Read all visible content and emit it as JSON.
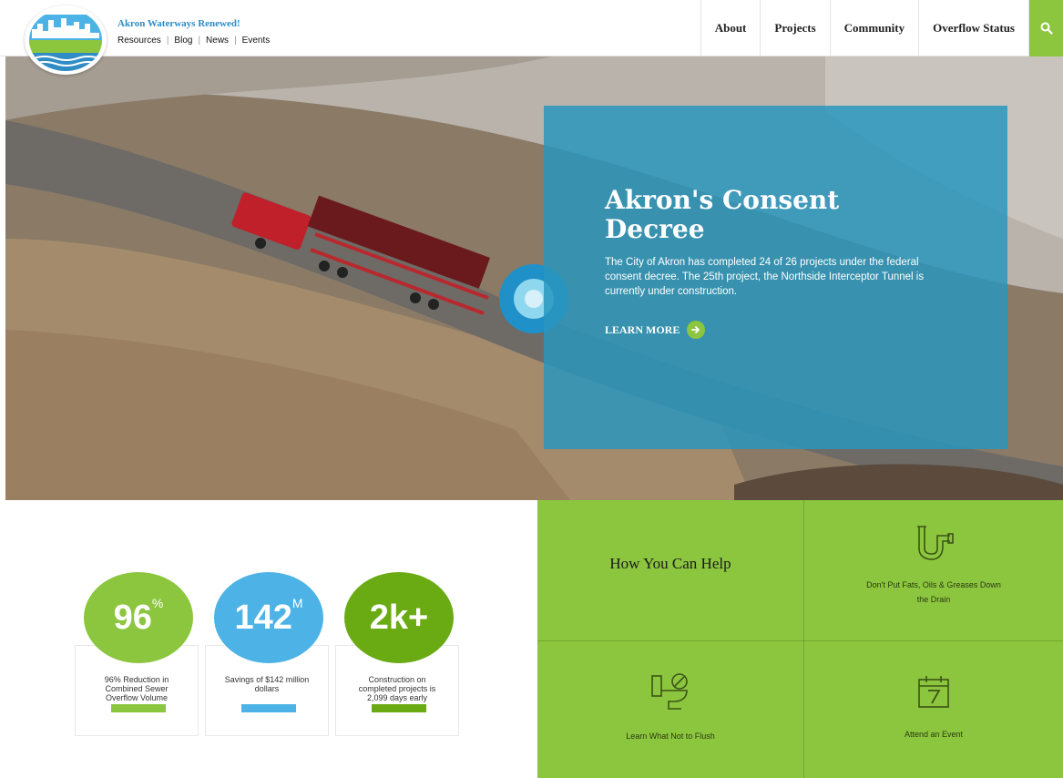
{
  "header": {
    "site_title": "Akron Waterways Renewed!",
    "utility_links": [
      "Resources",
      "Blog",
      "News",
      "Events"
    ],
    "nav": [
      "About",
      "Projects",
      "Community",
      "Overflow Status"
    ],
    "search_icon": "search-icon"
  },
  "hero": {
    "title": "Akron's Consent Decree",
    "text": "The City of Akron has completed 24 of 26 projects under the federal consent decree. The 25th project, the Northside Interceptor Tunnel is currently under construction.",
    "cta": "LEARN MORE"
  },
  "stats": [
    {
      "number": "96",
      "suffix": "%",
      "caption": "96% Reduction in Combined Sewer Overflow Volume",
      "color": "#8cc63f"
    },
    {
      "number": "142",
      "suffix": "M",
      "caption": "Savings of $142 million dollars",
      "color": "#4db3e6"
    },
    {
      "number": "2k+",
      "suffix": "",
      "caption": "Construction on completed projects is 2,099 days early",
      "color": "#6aab14"
    }
  ],
  "help": {
    "heading": "How You Can Help",
    "items": [
      {
        "label": "Don't Put Fats, Oils & Greases Down the Drain",
        "icon": "pipe-icon"
      },
      {
        "label": "Learn What Not to Flush",
        "icon": "toilet-icon"
      },
      {
        "label": "Attend an Event",
        "icon": "calendar-icon"
      }
    ]
  },
  "colors": {
    "green": "#8cc63f",
    "blue": "#2f8cc4",
    "panel": "#2896be"
  }
}
